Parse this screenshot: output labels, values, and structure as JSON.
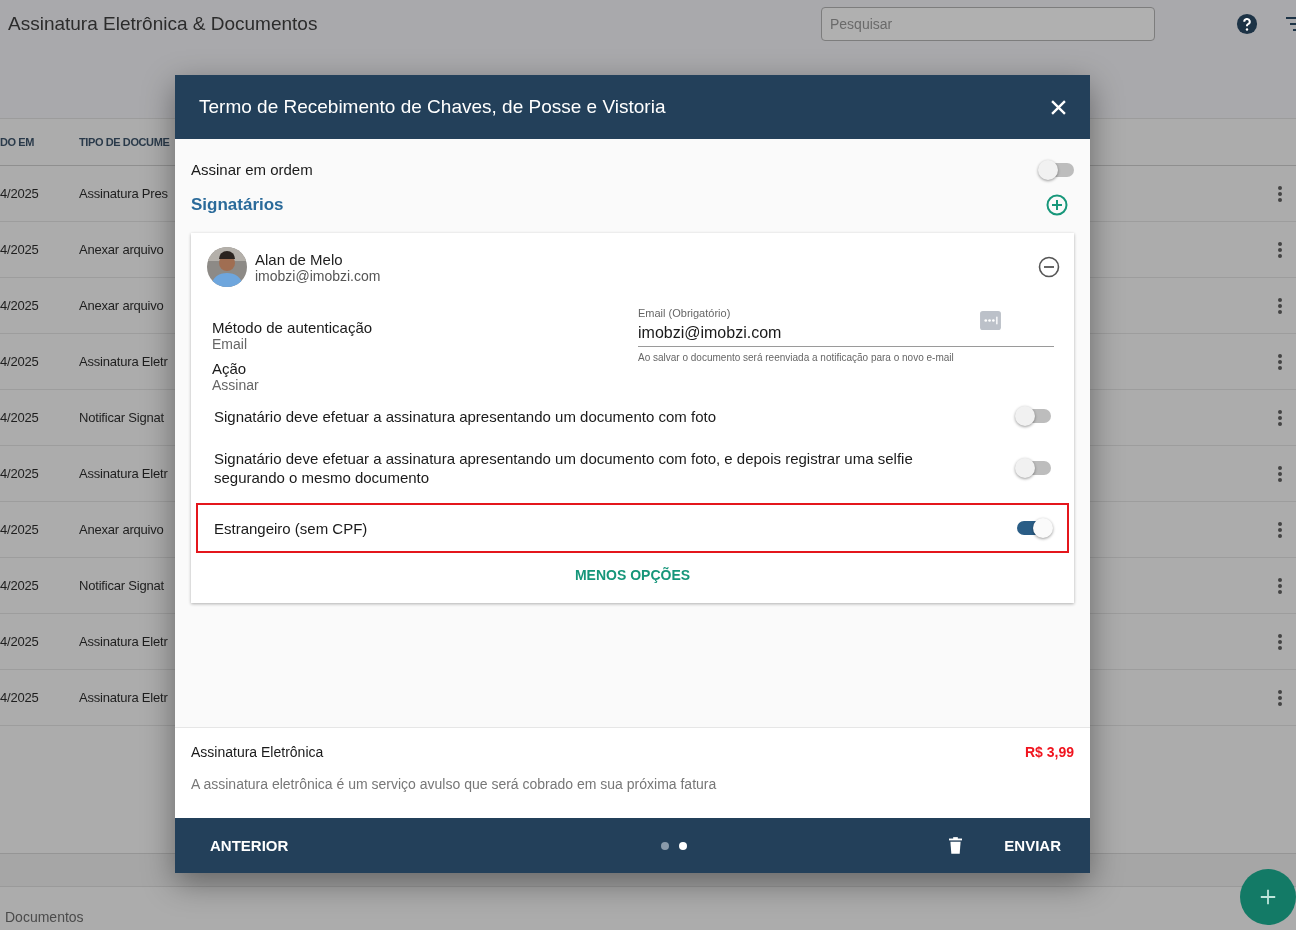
{
  "app": {
    "title": "Assinatura Eletrônica & Documentos",
    "search": {
      "placeholder": "Pesquisar"
    }
  },
  "table": {
    "columns": [
      "DO EM",
      "TIPO DE DOCUME"
    ],
    "rows": [
      {
        "cells": [
          "4/2025",
          "Assinatura Pres"
        ]
      },
      {
        "cells": [
          "4/2025",
          "Anexar arquivo"
        ]
      },
      {
        "cells": [
          "4/2025",
          "Anexar arquivo"
        ]
      },
      {
        "cells": [
          "4/2025",
          "Assinatura Eletr"
        ]
      },
      {
        "cells": [
          "4/2025",
          "Notificar Signat"
        ]
      },
      {
        "cells": [
          "4/2025",
          "Assinatura Eletr"
        ]
      },
      {
        "cells": [
          "4/2025",
          "Anexar arquivo"
        ]
      },
      {
        "cells": [
          "4/2025",
          "Notificar Signat"
        ]
      },
      {
        "cells": [
          "4/2025",
          "Assinatura Eletr"
        ]
      },
      {
        "cells": [
          "4/2025",
          "Assinatura Eletr"
        ]
      }
    ]
  },
  "bottom_tab": {
    "label": "Documentos"
  },
  "dialog": {
    "title": "Termo de Recebimento de Chaves, de Posse e Vistoria",
    "sign_in_order": {
      "label": "Assinar em ordem",
      "on": false
    },
    "signers_heading": "Signatários",
    "signer": {
      "name": "Alan de Melo",
      "email": "imobzi@imobzi.com",
      "auth_label": "Método de autenticação",
      "auth_value": "Email",
      "action_label": "Ação",
      "action_value": "Assinar",
      "email_field": {
        "label": "Email (Obrigatório)",
        "value": "imobzi@imobzi.com",
        "hint": "Ao salvar o documento será reenviada a notificação para o novo e-mail"
      },
      "options": [
        {
          "label": "Signatário deve efetuar a assinatura apresentando um documento com foto",
          "on": false,
          "highlighted": false
        },
        {
          "label": "Signatário deve efetuar a assinatura apresentando um documento com foto, e depois registrar uma selfie segurando o mesmo documento",
          "on": false,
          "highlighted": false
        },
        {
          "label": "Estrangeiro (sem CPF)",
          "on": true,
          "highlighted": true
        }
      ],
      "less_options": "MENOS OPÇÕES"
    },
    "price": {
      "label": "Assinatura Eletrônica",
      "value": "R$ 3,99",
      "note": "A assinatura eletrônica é um serviço avulso que será cobrado em sua próxima fatura"
    },
    "footer": {
      "back": "ANTERIOR",
      "send": "ENVIAR",
      "steps": [
        {
          "selected": false
        },
        {
          "selected": true
        }
      ]
    }
  }
}
